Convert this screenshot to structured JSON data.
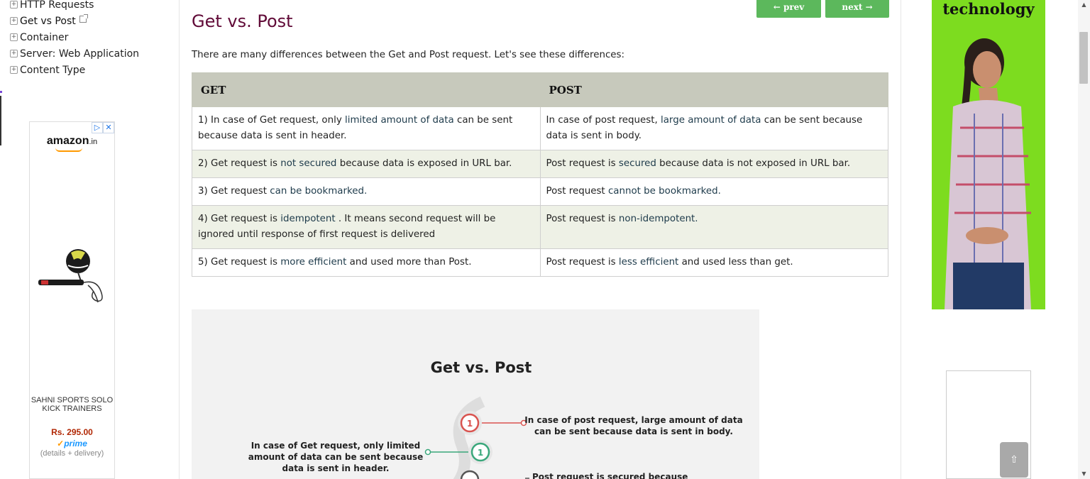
{
  "sidebar": {
    "items": [
      {
        "label": "HTTP Requests"
      },
      {
        "label": "Get vs Post"
      },
      {
        "label": "Container"
      },
      {
        "label": "Server: Web Application"
      },
      {
        "label": "Content Type"
      }
    ]
  },
  "amazon_ad": {
    "logo": "amazon",
    "logo_suffix": ".in",
    "adchoices": "▷",
    "close": "✕",
    "product_title": "SAHNI SPORTS SOLO KICK TRAINERS",
    "price": "Rs. 295.00",
    "prime": "prime",
    "prime_check": "✓",
    "delivery": "(details + delivery)"
  },
  "article": {
    "title": "Get vs. Post",
    "prev_label": "← prev",
    "next_label": "next →",
    "intro": "There are many differences between the Get and Post request. Let's see these differences:",
    "table": {
      "headers": [
        "GET",
        "POST"
      ],
      "rows": [
        {
          "get": {
            "pre": "1) In case of Get request, only ",
            "hl": "limited amount of data",
            "post": " can be sent because data is sent in header."
          },
          "post": {
            "pre": "In case of post request, ",
            "hl": "large amount of data",
            "post": " can be sent because data is sent in body."
          }
        },
        {
          "get": {
            "pre": "2) Get request is ",
            "hl": "not secured",
            "post": " because data is exposed in URL bar."
          },
          "post": {
            "pre": "Post request is ",
            "hl": "secured",
            "post": " because data is not exposed in URL bar."
          }
        },
        {
          "get": {
            "pre": "3) Get request ",
            "hl": "can be bookmarked.",
            "post": ""
          },
          "post": {
            "pre": "Post request ",
            "hl": "cannot be bookmarked.",
            "post": ""
          }
        },
        {
          "get": {
            "pre": "4) Get request is ",
            "hl": "idempotent",
            "post": " . It means second request will be ignored until response of first request is delivered"
          },
          "post": {
            "pre": "Post request is ",
            "hl": "non-idempotent.",
            "post": ""
          }
        },
        {
          "get": {
            "pre": "5) Get request is ",
            "hl": "more efficient",
            "post": " and used more than Post."
          },
          "post": {
            "pre": "Post request is ",
            "hl": "less efficient",
            "post": " and used less than get."
          }
        }
      ]
    },
    "infographic": {
      "title": "Get vs. Post",
      "post_text_1": "In case of post request, large amount of data can be sent because data is sent in body.",
      "get_text_1": "In case of Get request, only limited amount of data can be sent because data is sent in header.",
      "post_text_2": "Post request is secured because",
      "step_1": "1",
      "colors": {
        "post": "#d9534f",
        "get": "#3aa77b"
      }
    }
  },
  "right_ad": {
    "title": "technology"
  },
  "back_to_top": "⇧",
  "colors": {
    "title": "#610b38",
    "button": "#5cb85c",
    "table_header": "#c7c9bc",
    "ad_green": "#7ddc1f"
  }
}
